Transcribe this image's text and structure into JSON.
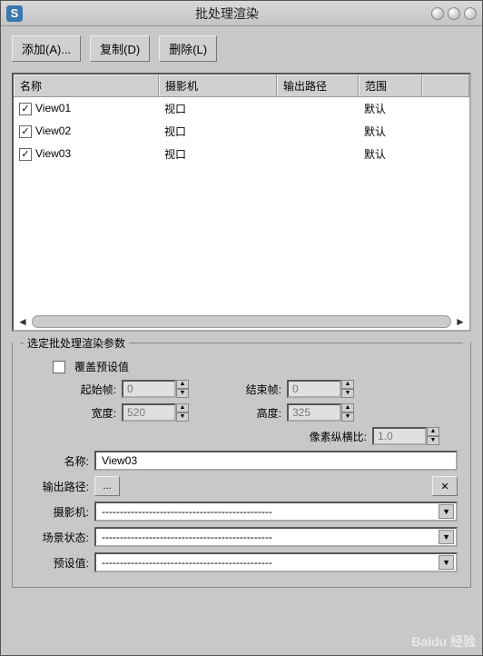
{
  "window": {
    "title": "批处理渲染",
    "app_icon_text": "S"
  },
  "toolbar": {
    "add": "添加(A)...",
    "copy": "复制(D)",
    "delete": "删除(L)"
  },
  "columns": {
    "name": "名称",
    "camera": "摄影机",
    "output": "输出路径",
    "range": "范围",
    "ext": ""
  },
  "rows": [
    {
      "checked": true,
      "name": "View01",
      "camera": "视口",
      "output": "",
      "range": "默认",
      "ext": ""
    },
    {
      "checked": true,
      "name": "View02",
      "camera": "视口",
      "output": "",
      "range": "默认",
      "ext": ""
    },
    {
      "checked": true,
      "name": "View03",
      "camera": "视口",
      "output": "",
      "range": "默认",
      "ext": ""
    }
  ],
  "params": {
    "group_title": "选定批处理渲染参数",
    "override": "覆盖预设值",
    "override_checked": false,
    "start_frame_label": "起始帧:",
    "start_frame": "0",
    "end_frame_label": "结束帧:",
    "end_frame": "0",
    "width_label": "宽度:",
    "width": "520",
    "height_label": "高度:",
    "height": "325",
    "aspect_label": "像素纵横比:",
    "aspect": "1.0",
    "name_label": "名称:",
    "name": "View03",
    "output_label": "输出路径:",
    "output_btn": "...",
    "output_clear": "✕",
    "camera_label": "摄影机:",
    "scene_state_label": "场景状态:",
    "preset_label": "预设值:",
    "dashes": "-----------------------------------------------"
  },
  "watermark": "Baidu 经验"
}
